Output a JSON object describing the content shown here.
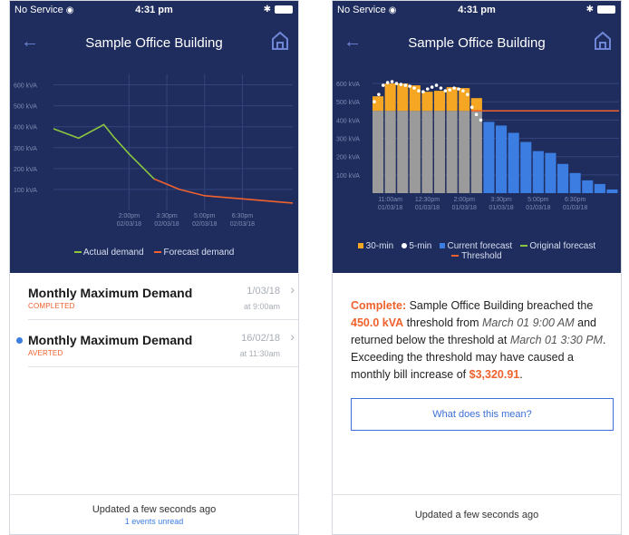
{
  "status": {
    "carrier": "No Service",
    "time": "4:31 pm"
  },
  "left": {
    "title": "Sample Office Building",
    "chart_data": {
      "type": "line",
      "y_ticks": [
        "600 kVA",
        "500 kVA",
        "400 kVA",
        "300 kVA",
        "200 kVA",
        "100 kVA"
      ],
      "x_ticks": [
        {
          "time": "2:00pm",
          "date": "02/03/18"
        },
        {
          "time": "3:30pm",
          "date": "02/03/18"
        },
        {
          "time": "5:00pm",
          "date": "02/03/18"
        },
        {
          "time": "6:30pm",
          "date": "02/03/18"
        }
      ],
      "ylim": [
        0,
        650
      ],
      "series": [
        {
          "name": "Actual demand",
          "color": "#8cc63f",
          "points": [
            [
              -1,
              390
            ],
            [
              0,
              345
            ],
            [
              1,
              410
            ],
            [
              1.4,
              350
            ],
            [
              2,
              270
            ],
            [
              3,
              150
            ]
          ]
        },
        {
          "name": "Forecast demand",
          "color": "#f0622d",
          "points": [
            [
              3,
              150
            ],
            [
              4,
              100
            ],
            [
              5,
              70
            ],
            [
              6,
              60
            ],
            [
              7,
              50
            ],
            [
              8,
              40
            ],
            [
              8.5,
              35
            ]
          ]
        }
      ]
    },
    "events": [
      {
        "title": "Monthly Maximum Demand",
        "status": "COMPLETED",
        "date": "1/03/18",
        "time": "at 9:00am",
        "unread": false
      },
      {
        "title": "Monthly Maximum Demand",
        "status": "AVERTED",
        "date": "16/02/18",
        "time": "at 11:30am",
        "unread": true
      }
    ],
    "footer": {
      "updated": "Updated a few seconds ago",
      "unread": "1 events unread"
    }
  },
  "right": {
    "title": "Sample Office Building",
    "chart_data": {
      "type": "bar",
      "y_ticks": [
        "600 kVA",
        "500 kVA",
        "400 kVA",
        "300 kVA",
        "200 kVA",
        "100 kVA"
      ],
      "x_ticks": [
        {
          "time": "11:00am",
          "date": "01/03/18"
        },
        {
          "time": "12:30pm",
          "date": "01/03/18"
        },
        {
          "time": "2:00pm",
          "date": "01/03/18"
        },
        {
          "time": "3:30pm",
          "date": "01/03/18"
        },
        {
          "time": "5:00pm",
          "date": "01/03/18"
        },
        {
          "time": "6:30pm",
          "date": "01/03/18"
        }
      ],
      "ylim": [
        0,
        650
      ],
      "threshold": 450,
      "thirty_min": [
        530,
        600,
        600,
        590,
        555,
        560,
        580,
        575,
        520
      ],
      "current_forecast": [
        390,
        370,
        330,
        280,
        230,
        220,
        160,
        110,
        70,
        50,
        20
      ],
      "five_min": [
        500,
        540,
        590,
        605,
        610,
        600,
        595,
        590,
        585,
        575,
        560,
        555,
        570,
        580,
        590,
        575,
        560,
        565,
        575,
        570,
        560,
        540,
        470,
        430,
        400
      ],
      "legend": {
        "thirty_min": "30-min",
        "five_min": "5-min",
        "current": "Current forecast",
        "original": "Original forecast",
        "threshold": "Threshold"
      },
      "colors": {
        "over": "#f5a623",
        "under": "#9b9b9b",
        "forecast": "#3b7de0",
        "threshold": "#f0622d",
        "original": "#8cc63f",
        "dots": "#ffffff"
      }
    },
    "message": {
      "complete_label": "Complete:",
      "p1": " Sample Office Building breached the ",
      "threshold_value": "450.0 kVA",
      "p2": " threshold from ",
      "from_time": "March 01 9:00 AM",
      "p3": " and returned below the threshold at ",
      "to_time": "March 01 3:30 PM",
      "p4": ". Exceeding the threshold may have caused a monthly bill increase of ",
      "amount": "$3,320.91",
      "p5": "."
    },
    "button": "What does this mean?",
    "footer": {
      "updated": "Updated a few seconds ago"
    }
  }
}
